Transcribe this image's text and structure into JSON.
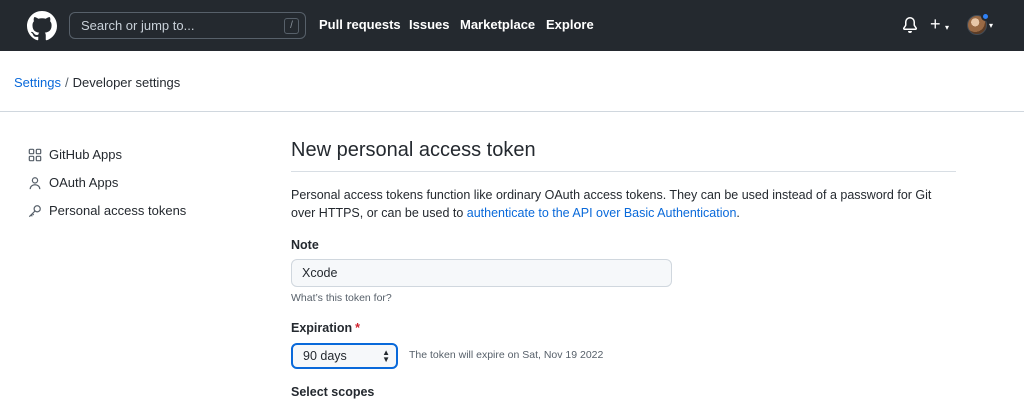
{
  "header": {
    "search_placeholder": "Search or jump to...",
    "search_shortcut": "/",
    "nav": [
      "Pull requests",
      "Issues",
      "Marketplace",
      "Explore"
    ],
    "plus_symbol": "+",
    "caret_symbol": "▾"
  },
  "breadcrumb": {
    "parent": "Settings",
    "separator": "/",
    "current": "Developer settings"
  },
  "sidebar": {
    "items": [
      {
        "label": "GitHub Apps",
        "icon": "apps-grid-icon"
      },
      {
        "label": "OAuth Apps",
        "icon": "person-icon"
      },
      {
        "label": "Personal access tokens",
        "icon": "key-icon"
      }
    ]
  },
  "main": {
    "title": "New personal access token",
    "description_before": "Personal access tokens function like ordinary OAuth access tokens. They can be used instead of a password for Git over HTTPS, or can be used to ",
    "description_link": "authenticate to the API over Basic Authentication",
    "description_after": ".",
    "note_label": "Note",
    "note_value": "Xcode",
    "note_hint": "What’s this token for?",
    "expiration_label": "Expiration",
    "required_mark": "*",
    "expiration_value": "90 days",
    "expiration_note": "The token will expire on Sat, Nov 19 2022",
    "scopes_label": "Select scopes"
  },
  "colors": {
    "header_bg": "#24292f",
    "link": "#0969da",
    "required": "#cf222e",
    "notification_dot": "#2f81f7"
  }
}
